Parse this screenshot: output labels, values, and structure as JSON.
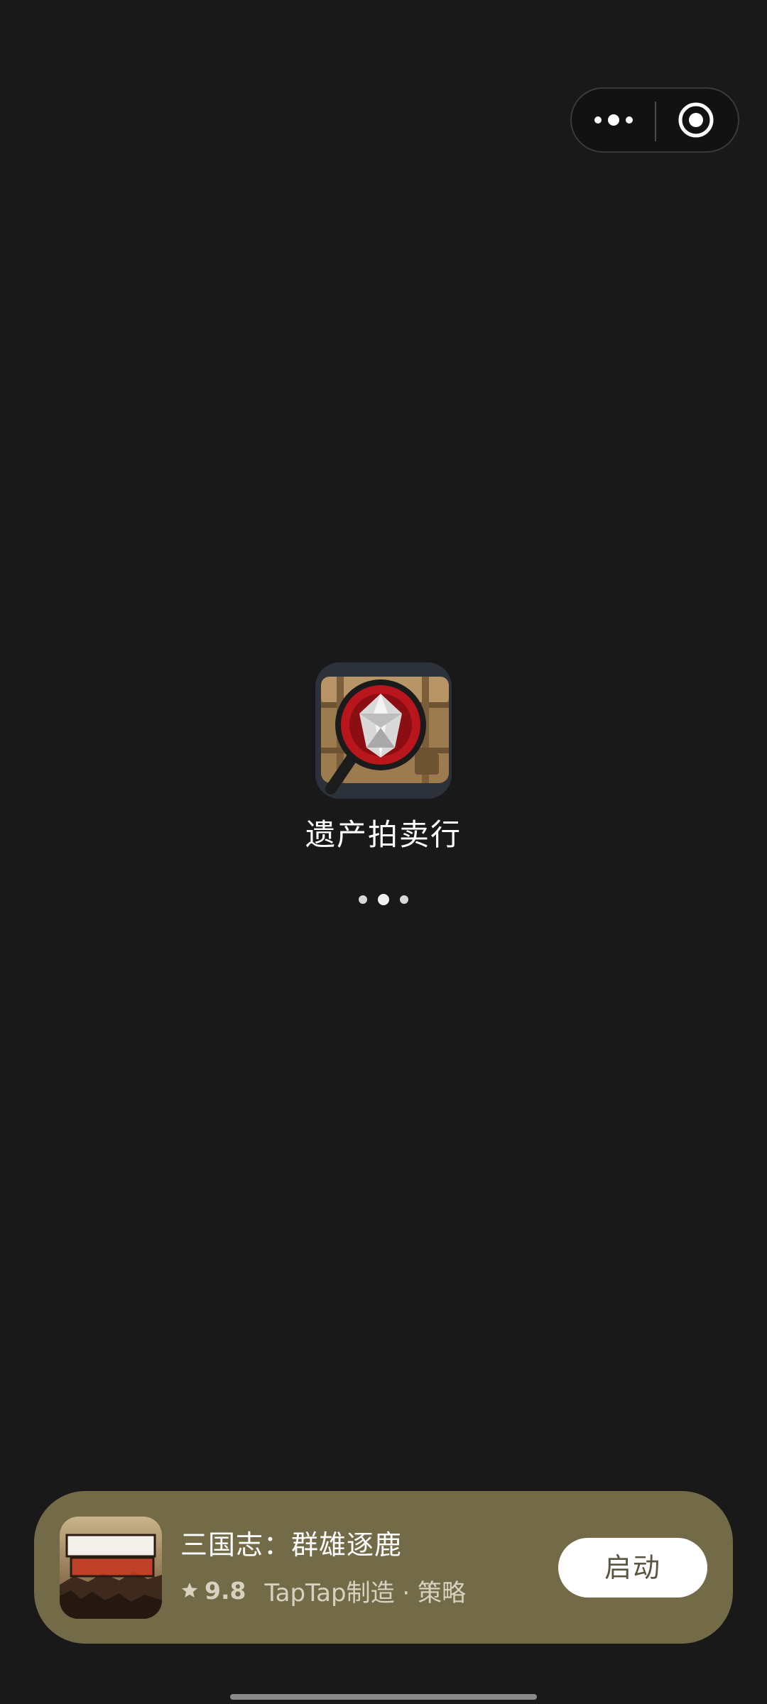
{
  "capsule": {
    "more_icon": "more-dots-icon",
    "close_icon": "target-close-icon"
  },
  "splash": {
    "app_name": "遗产拍卖行",
    "app_icon": "treasure-chest-magnifier-icon",
    "loading_indicator": "loading-dots-icon"
  },
  "promo": {
    "title": "三国志：群雄逐鹿",
    "icon": "game-thumbnail-icon",
    "rating": "9.8",
    "meta": "TapTap制造 · 策略",
    "launch_label": "启动"
  },
  "colors": {
    "background": "#191919",
    "promo_card": "#736b48",
    "button_bg": "#ffffff"
  }
}
